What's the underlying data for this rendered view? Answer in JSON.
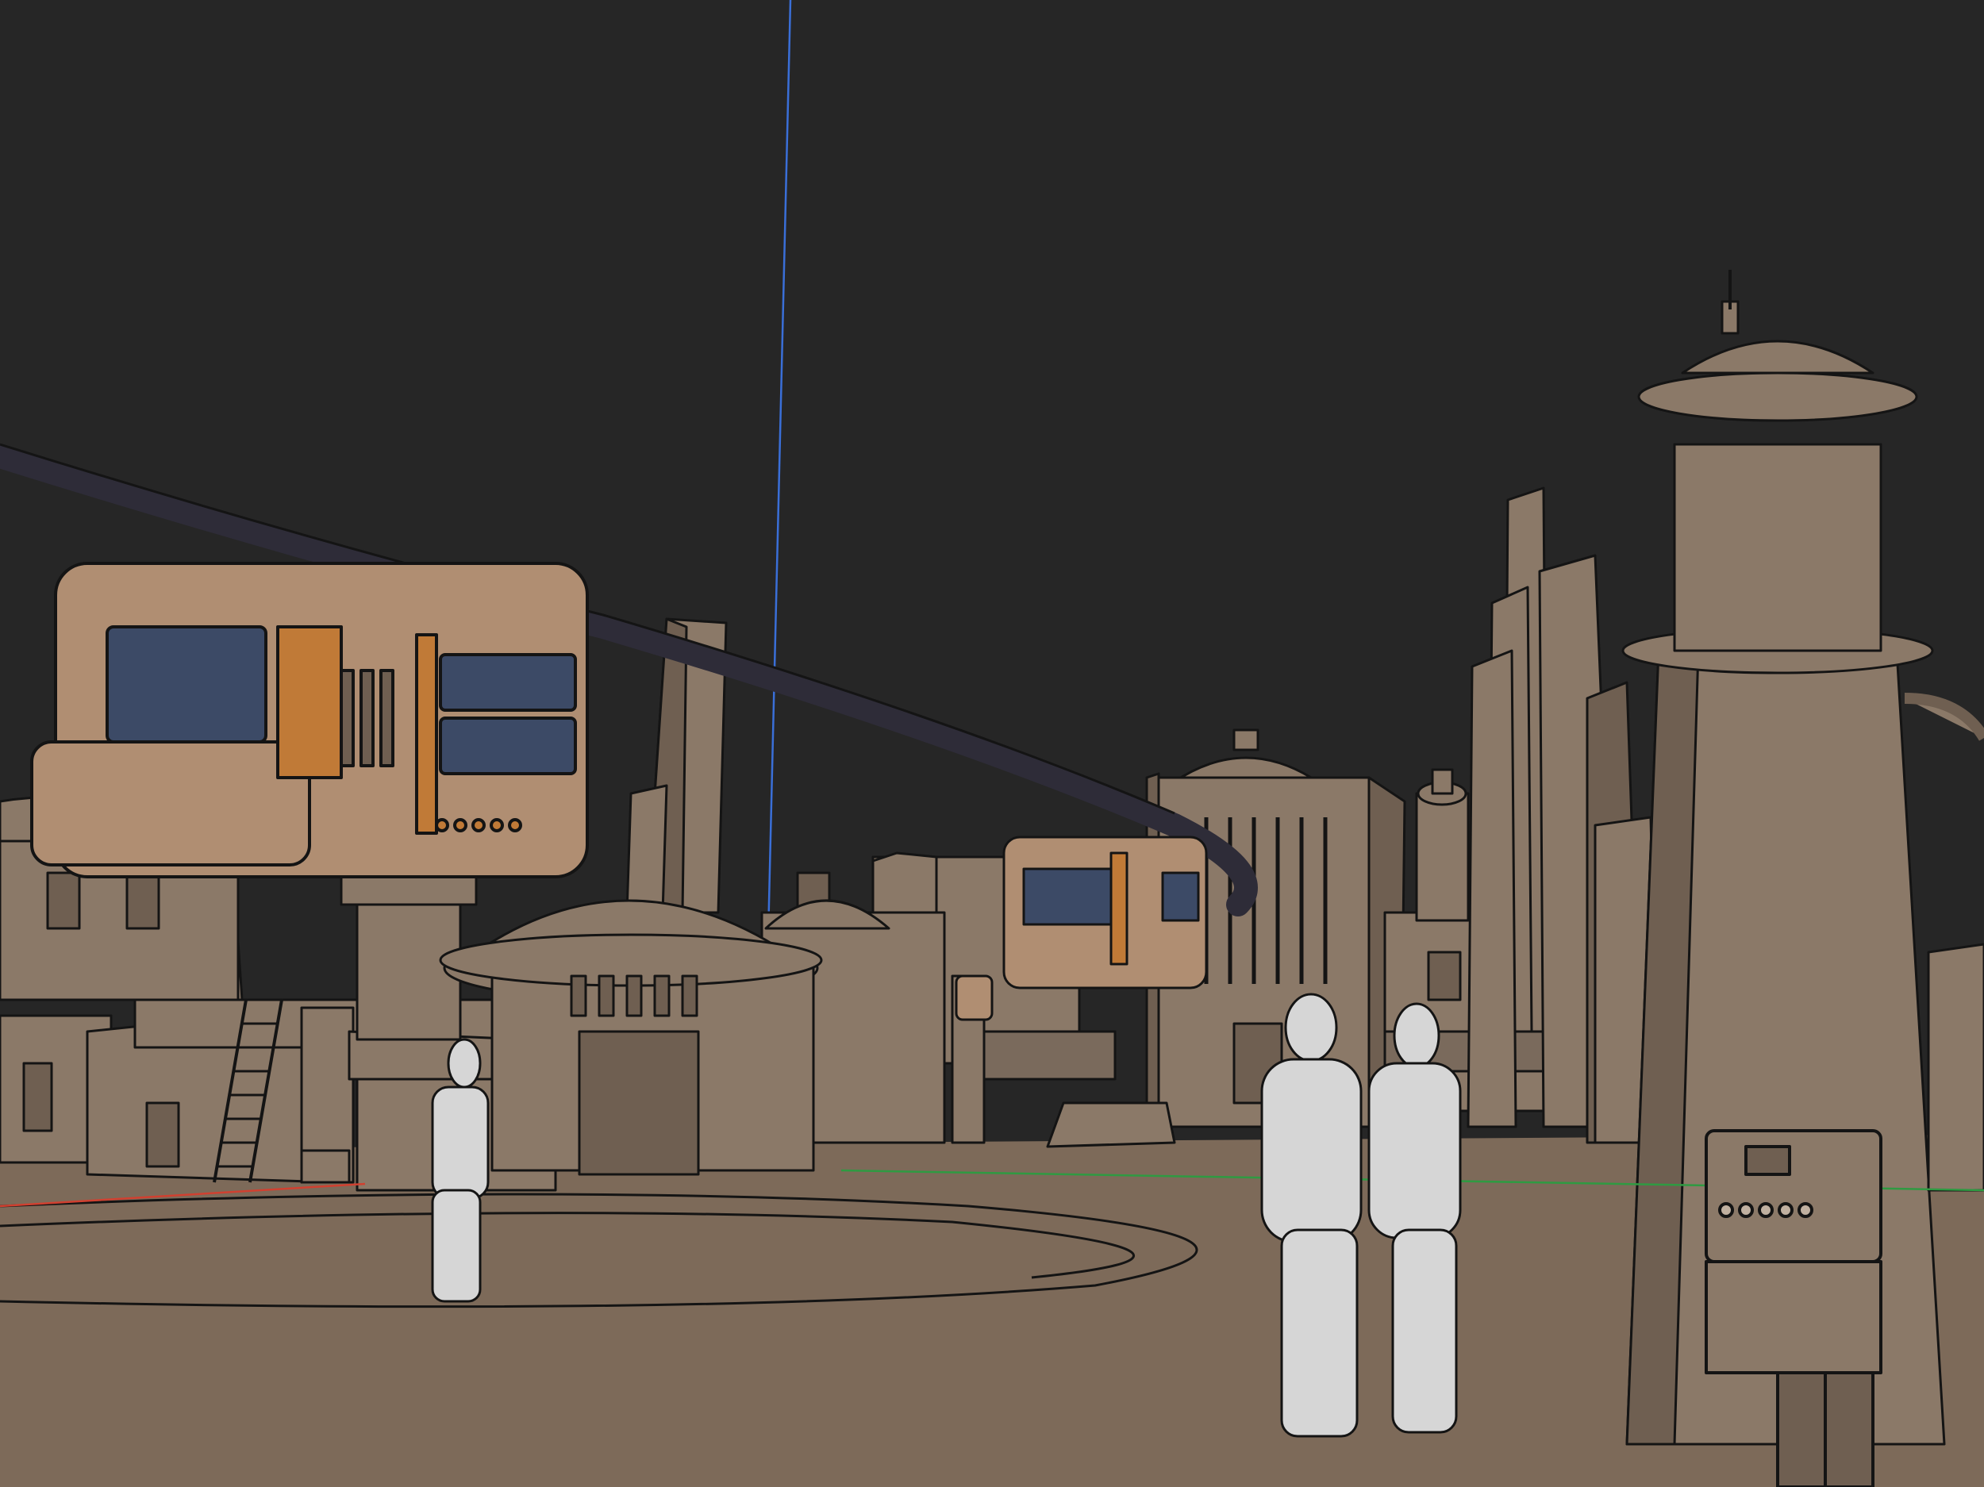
{
  "viewport": {
    "mode": "3d-modeling-viewport",
    "colors": {
      "background": "#262626",
      "ground": "#7d6a59",
      "building": "#8b7968",
      "building_light": "#9a8776",
      "building_dark": "#6f5f51",
      "outline": "#141414",
      "tram_body": "#b08e72",
      "tram_accent": "#c07a37",
      "tram_window": "#3c4a66",
      "monorail": "#2e2c38",
      "figure": "#d6d6d6",
      "axis_blue": "#3a6fd8",
      "axis_red": "#d04030",
      "axis_green": "#2f9a42"
    }
  }
}
